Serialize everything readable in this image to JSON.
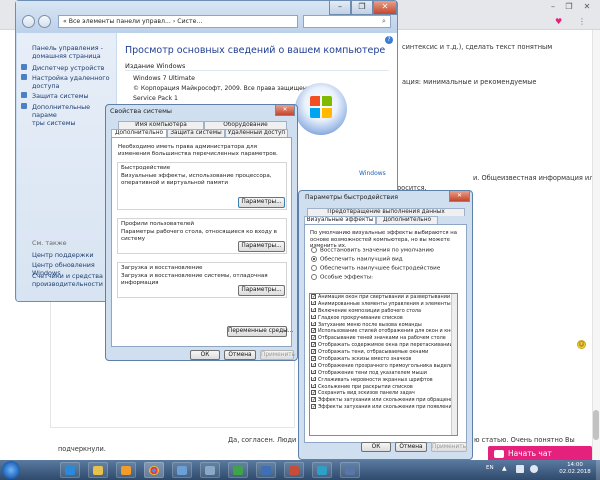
{
  "browser": {
    "page_lines": [
      "синтексис и т.д.), сделать текст понятным",
      "ация: минимальные и рекомендуемые",
      "и. Общеизвестная информация или",
      "росится."
    ],
    "comment_text": "Да, согласен. Люди",
    "comment_text2": "ю статью. Очень понятно Вы",
    "comment_text3": "подчеркнули.",
    "chat_label": "Начать чат",
    "accent": "#e6217d"
  },
  "syswin": {
    "address": "« Все элементы панели управл... › Систе...",
    "left_links": [
      "Панель управления -",
      "домашняя страница",
      "Диспетчер устройств",
      "Настройка удаленного",
      "доступа",
      "Защита системы",
      "Дополнительные параме",
      "тры системы"
    ],
    "see_also_title": "См. также",
    "see_also": [
      "Центр поддержки",
      "Центр обновления Windows",
      "Счетчики и средства",
      "производительности"
    ],
    "heading": "Просмотр основных сведений о вашем компьютере",
    "edition_title": "Издание Windows",
    "edition": "Windows 7 Ultimate",
    "copyright": "© Корпорация Майкрософт, 2009. Все права защищены.",
    "service_pack": "Service Pack 1",
    "windows_link": "Windows"
  },
  "props": {
    "title": "Свойства системы",
    "tabs_row1": [
      "Имя компьютера",
      "Оборудование"
    ],
    "tabs_row2": [
      "Дополнительно",
      "Защита системы",
      "Удаленный доступ"
    ],
    "admin_note": "Необходимо иметь права администратора для изменения большинства перечисленных параметров.",
    "perf_title": "Быстродействие",
    "perf_desc": "Визуальные эффекты, использование процессора, оперативной и виртуальной памяти",
    "profiles_title": "Профили пользователей",
    "profiles_desc": "Параметры рабочего стола, относящиеся ко входу в систему",
    "startup_title": "Загрузка и восстановление",
    "startup_desc": "Загрузка и восстановление системы, отладочная информация",
    "params_btn": "Параметры...",
    "env_btn": "Переменные среды...",
    "ok": "ОК",
    "cancel": "Отмена",
    "apply": "Применить"
  },
  "perf": {
    "title": "Параметры быстродействия",
    "tab_top": "Предотвращение выполнения данных",
    "tabs": [
      "Визуальные эффекты",
      "Дополнительно"
    ],
    "intro": "По умолчанию визуальные эффекты выбираются на основе возможностей компьютера, но вы можете изменить их.",
    "radios": [
      "Восстановить значения по умолчанию",
      "Обеспечить наилучший вид",
      "Обеспечить наилучшее быстродействие",
      "Особые эффекты:"
    ],
    "selected_radio": 1,
    "options": [
      "Анимация окон при свертывании и развертывании",
      "Анимированные элементы управления и элементы вн",
      "Включение композиции рабочего стола",
      "Гладкое прокручивание списков",
      "Затухание меню после вызова команды",
      "Использование стилей отображения для окон и кнопо",
      "Отбрасывание теней значками на рабочем столе",
      "Отображать содержимое окна при перетаскивании",
      "Отображать тени, отбрасываемые окнами",
      "Отображать эскизы вместо значков",
      "Отображение прозрачного прямоугольника выделени",
      "Отображение тени под указателем мыши",
      "Сглаживать неровности экранных шрифтов",
      "Скольжение при раскрытии списков",
      "Сохранить вид эскизов панели задач",
      "Эффекты затухания или скольжения при обращении к",
      "Эффекты затухания или скольжения при появлении п"
    ],
    "ok": "ОК",
    "cancel": "Отмена",
    "apply": "Применить"
  },
  "taskbar": {
    "lang": "EN",
    "time": "14:00",
    "date": "02.02.2018"
  }
}
